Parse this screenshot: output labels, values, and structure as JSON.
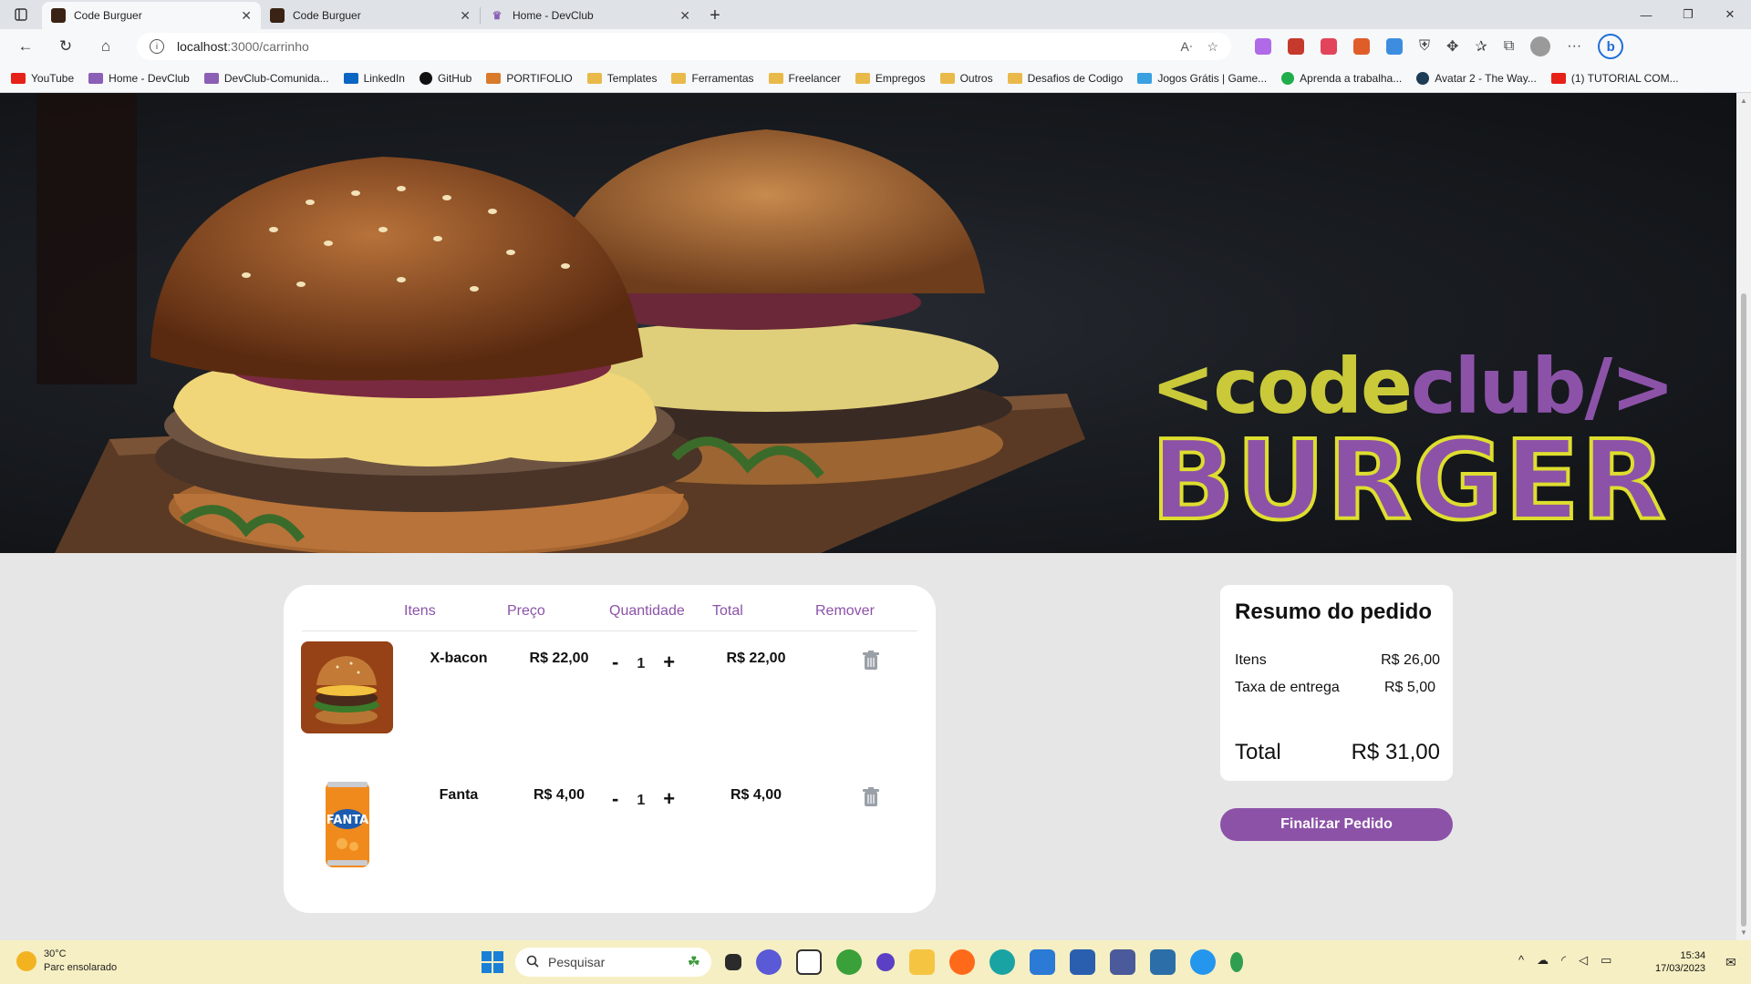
{
  "browser": {
    "tabs": [
      {
        "title": "Code Burguer",
        "active": true
      },
      {
        "title": "Code Burguer",
        "active": false
      },
      {
        "title": "Home - DevClub",
        "active": false
      }
    ],
    "url_host": "localhost",
    "url_path": ":3000/carrinho",
    "bookmarks": [
      "YouTube",
      "Home - DevClub",
      "DevClub-Comunida...",
      "LinkedIn",
      "GitHub",
      "PORTIFOLIO",
      "Templates",
      "Ferramentas",
      "Freelancer",
      "Empregos",
      "Outros",
      "Desafios de Codigo",
      "Jogos Grátis | Game...",
      "Aprenda a trabalha...",
      "Avatar 2 - The Way...",
      "(1) TUTORIAL COM..."
    ]
  },
  "hero": {
    "logo_code": "<code",
    "logo_club": "club/>",
    "logo_burger": "BURGER"
  },
  "cart": {
    "headers": [
      "Itens",
      "Preço",
      "Quantidade",
      "Total",
      "Remover"
    ],
    "items": [
      {
        "name": "X-bacon",
        "price": "R$ 22,00",
        "quantity": "1",
        "total": "R$ 22,00",
        "minus": "-",
        "plus": "+"
      },
      {
        "name": "Fanta",
        "price": "R$ 4,00",
        "quantity": "1",
        "total": "R$ 4,00",
        "minus": "-",
        "plus": "+"
      }
    ]
  },
  "summary": {
    "title": "Resumo do pedido",
    "items_label": "Itens",
    "items_value": "R$ 26,00",
    "delivery_label": "Taxa de entrega",
    "delivery_value": "R$ 5,00",
    "total_label": "Total",
    "total_value": "R$ 31,00",
    "button": "Finalizar Pedido"
  },
  "taskbar": {
    "temp": "30°C",
    "weather": "Parc ensolarado",
    "search_placeholder": "Pesquisar",
    "time": "15:34",
    "date": "17/03/2023"
  },
  "colors": {
    "brand_purple": "#8c52a8",
    "brand_yellow": "#c9c93a"
  }
}
